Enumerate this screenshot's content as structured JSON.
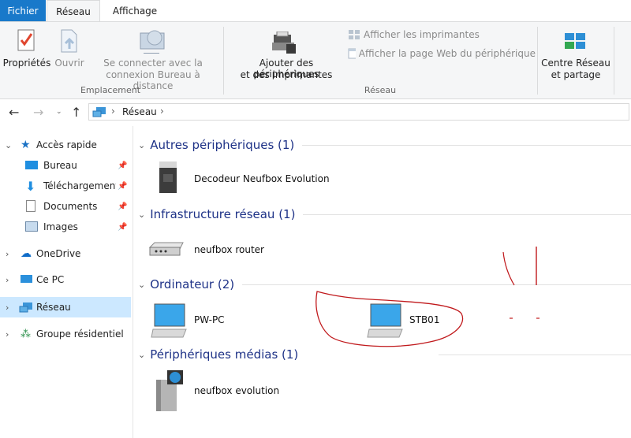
{
  "ribbon_tabs": {
    "file": "Fichier",
    "network": "Réseau",
    "view": "Affichage"
  },
  "ribbon": {
    "properties": "Propriétés",
    "open": "Ouvrir",
    "remote_line1": "Se connecter avec la",
    "remote_line2": "connexion Bureau à distance",
    "location_group": "Emplacement",
    "add_line1": "Ajouter des périphériques",
    "add_line2": "et des imprimantes",
    "show_printers": "Afficher les imprimantes",
    "show_webpage": "Afficher la page Web du périphérique",
    "network_group": "Réseau",
    "center_line1": "Centre Réseau",
    "center_line2": "et partage"
  },
  "address": {
    "crumb": "Réseau"
  },
  "sidebar": {
    "quick_access": "Accès rapide",
    "desktop": "Bureau",
    "downloads": "Téléchargements",
    "documents": "Documents",
    "images": "Images",
    "onedrive": "OneDrive",
    "this_pc": "Ce PC",
    "network": "Réseau",
    "homegroup": "Groupe résidentiel"
  },
  "groups": {
    "other": {
      "title": "Autres périphériques (1)",
      "item": "Decodeur Neufbox Evolution"
    },
    "infra": {
      "title": "Infrastructure réseau (1)",
      "item": "neufbox router"
    },
    "computers": {
      "title": "Ordinateur (2)",
      "item1": "PW-PC",
      "item2": "STB01"
    },
    "media": {
      "title": "Périphériques médias (1)",
      "item": "neufbox evolution"
    }
  },
  "colors": {
    "accent": "#1979ca",
    "group_title": "#1e3287",
    "selection": "#cce8ff",
    "annotation": "#c0191c"
  }
}
